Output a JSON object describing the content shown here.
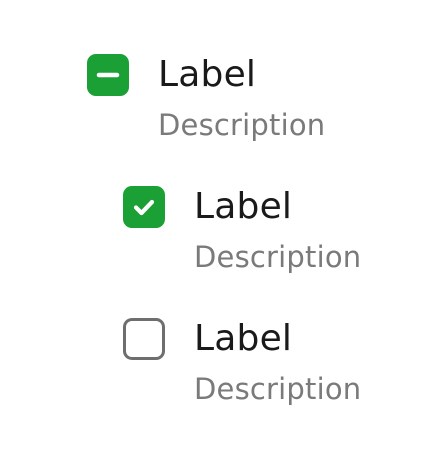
{
  "colors": {
    "accent": "#1aa035",
    "unchecked_border": "#6e6e6e",
    "label_text": "#1a1a1a",
    "description_text": "#7a7a7a"
  },
  "items": [
    {
      "label": "Label",
      "description": "Description",
      "state": "indeterminate",
      "icon": "minus-icon"
    },
    {
      "label": "Label",
      "description": "Description",
      "state": "checked",
      "icon": "check-icon"
    },
    {
      "label": "Label",
      "description": "Description",
      "state": "unchecked",
      "icon": ""
    }
  ]
}
